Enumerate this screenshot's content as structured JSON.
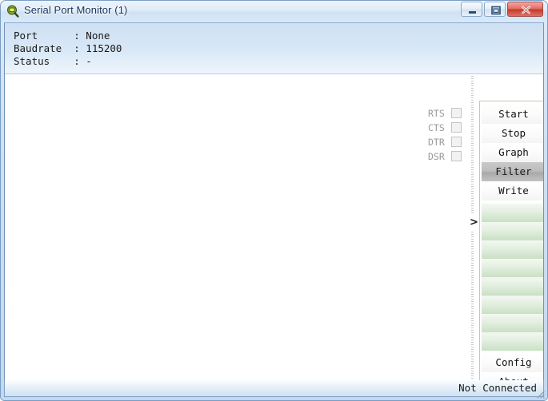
{
  "window": {
    "title": "Serial Port Monitor (1)",
    "icon": "monitor-magnifier-icon",
    "controls": {
      "minimize": "minimize-icon",
      "maximize": "maximize-icon",
      "close": "close-icon"
    }
  },
  "info": {
    "rows": [
      {
        "label": "Port",
        "sep": ":",
        "value": "None"
      },
      {
        "label": "Baudrate",
        "sep": ":",
        "value": "115200"
      },
      {
        "label": "Status",
        "sep": ":",
        "value": "-"
      }
    ],
    "lines": [
      "Port      : None",
      "Baudrate  : 115200",
      "Status    : -"
    ]
  },
  "signals": [
    {
      "label": "RTS",
      "checked": false,
      "enabled": false
    },
    {
      "label": "CTS",
      "checked": false,
      "enabled": false
    },
    {
      "label": "DTR",
      "checked": false,
      "enabled": false
    },
    {
      "label": "DSR",
      "checked": false,
      "enabled": false
    }
  ],
  "buttons": {
    "start": "Start",
    "stop": "Stop",
    "graph": "Graph",
    "filter": "Filter",
    "write": "Write",
    "config": "Config",
    "about": "About"
  },
  "macro_slots": [
    "",
    "",
    "",
    "",
    "",
    "",
    "",
    ""
  ],
  "splitter": {
    "vertical_arrow": ">",
    "horizontal_grip": "grip-dots"
  },
  "statusbar": {
    "text": "Not Connected"
  },
  "colors": {
    "titlebar_text": "#15325c",
    "close_button": "#c6392c",
    "panel_border_green": "#b6d2b0",
    "slot_green": "#c9e0c4",
    "splitter_green": "#d6e8d1",
    "active_button_gray": "#a9a9a9",
    "info_panel_blue": "#d9e8f7"
  }
}
